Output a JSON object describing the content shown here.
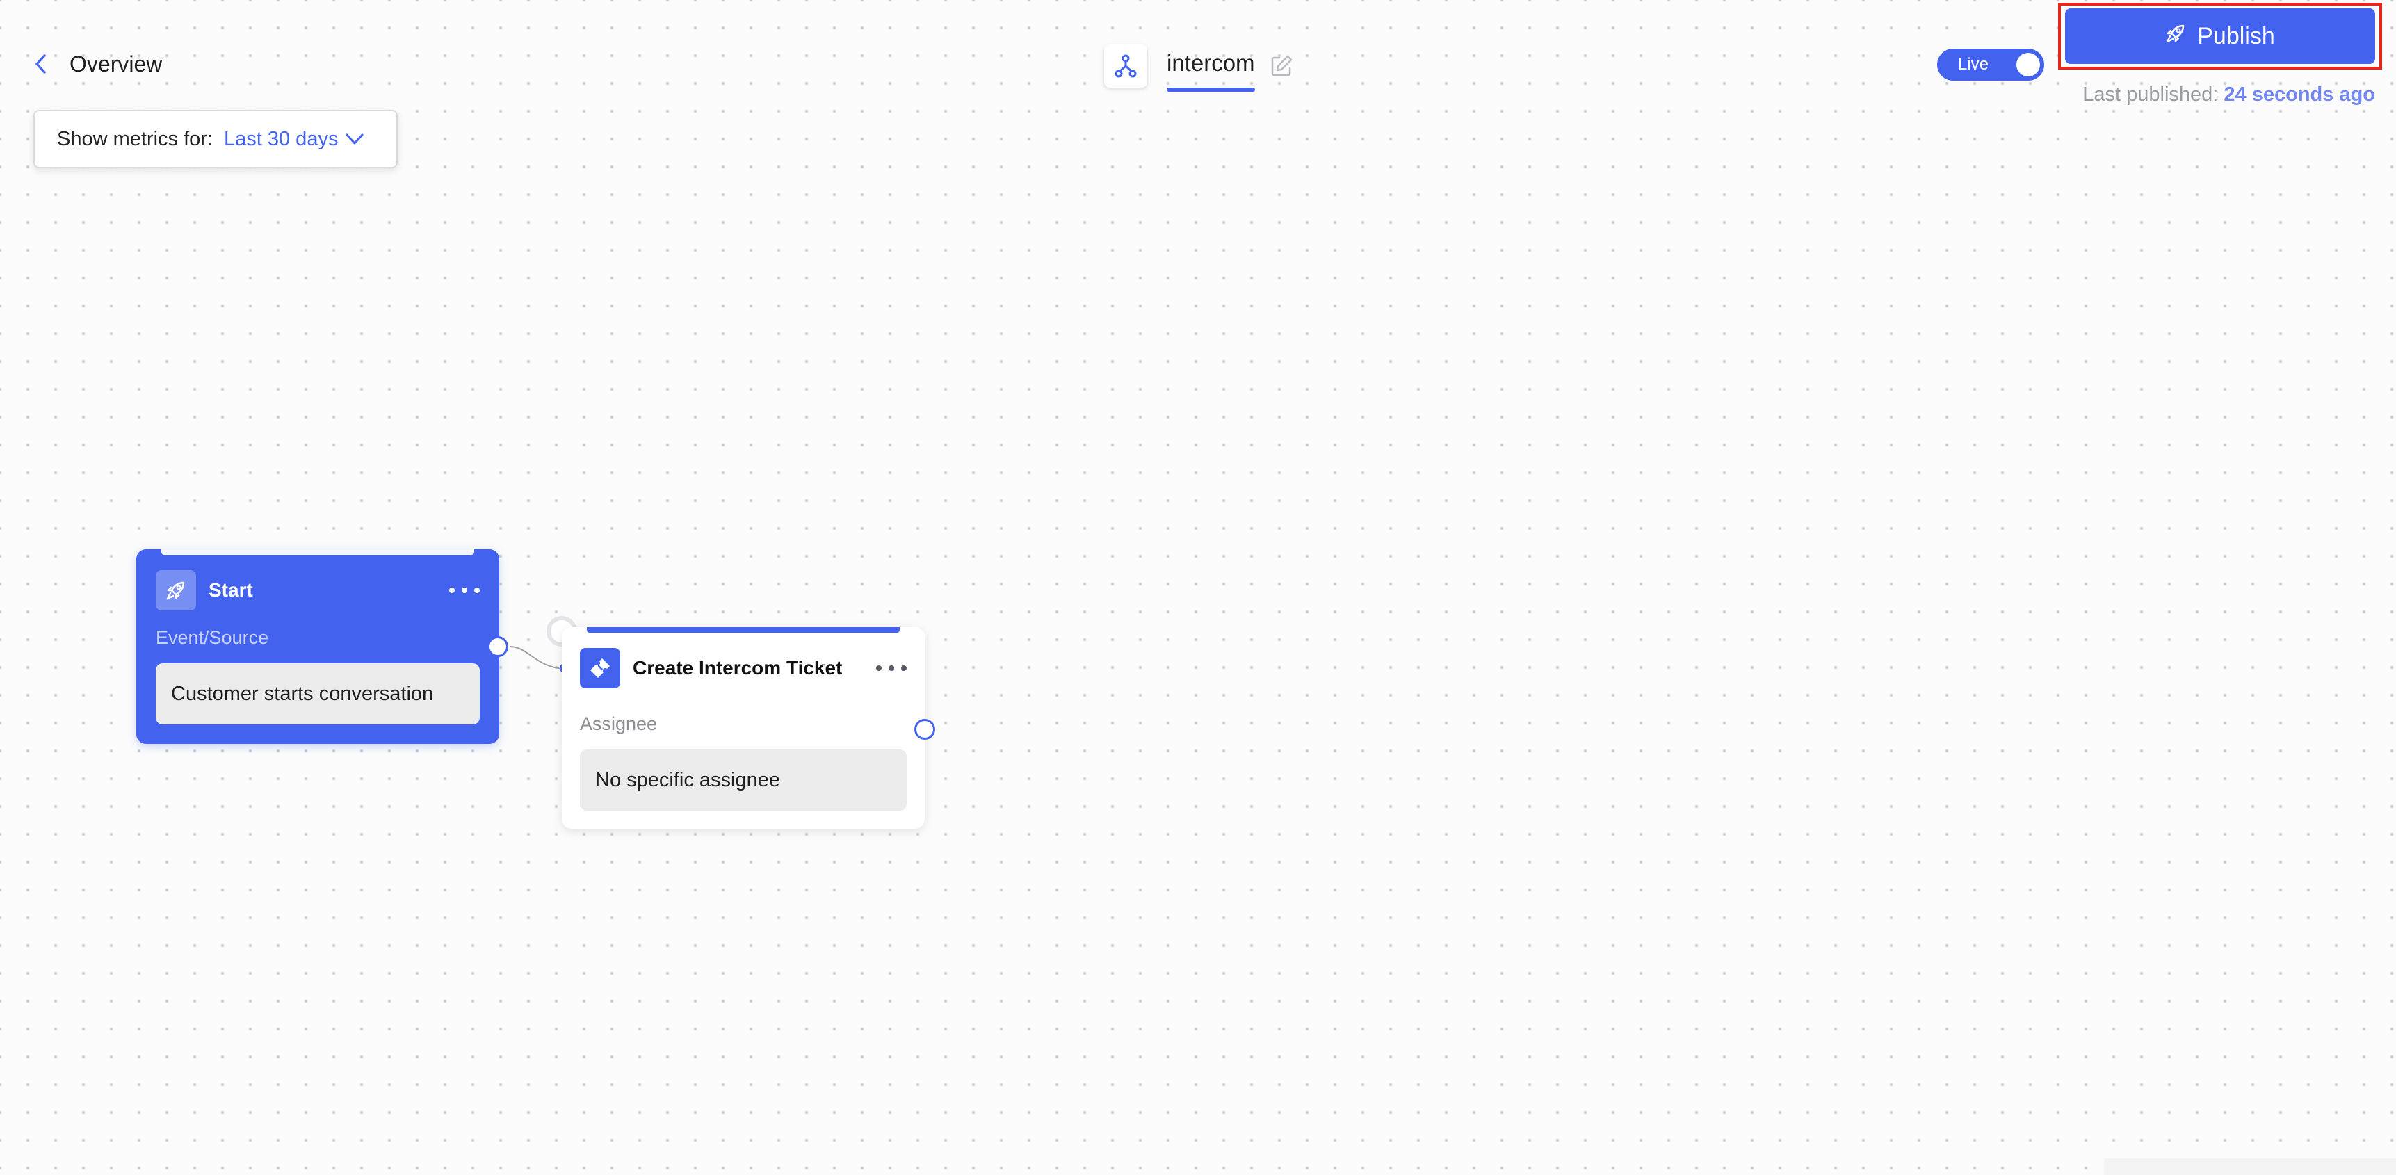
{
  "header": {
    "back_label": "Overview",
    "flow_title": "intercom",
    "live_label": "Live",
    "publish_label": "Publish",
    "last_published_label": "Last published:",
    "last_published_time": "24 seconds ago"
  },
  "metrics": {
    "label": "Show metrics for:",
    "value": "Last 30 days"
  },
  "nodes": {
    "start": {
      "title": "Start",
      "field_label": "Event/Source",
      "field_value": "Customer starts conversation"
    },
    "ticket": {
      "title": "Create Intercom Ticket",
      "field_label": "Assignee",
      "field_value": "No specific assignee"
    }
  },
  "icons": {
    "back": "chevron-left-icon",
    "flow": "flow-branch-icon",
    "edit": "pencil-square-icon",
    "publish": "rocket-icon",
    "metrics_dropdown": "chevron-down-icon",
    "start_node": "rocket-icon",
    "ticket_node": "ticket-icon",
    "node_menu": "ellipsis-icon"
  },
  "colors": {
    "accent": "#4363ef",
    "highlight": "#e5261d",
    "field_bg": "#ebebeb"
  },
  "toggle": {
    "live_on": true
  }
}
